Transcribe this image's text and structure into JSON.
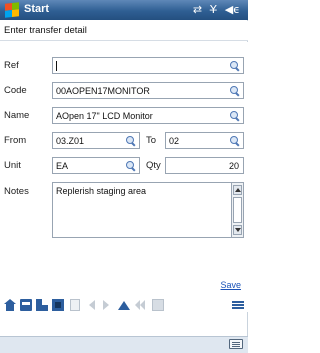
{
  "titlebar": {
    "title": "Start",
    "icons": [
      "windows-logo-icon",
      "connectivity-icon",
      "signal-icon",
      "volume-icon"
    ]
  },
  "header": {
    "text": "Enter transfer detail"
  },
  "form": {
    "ref": {
      "label": "Ref",
      "value": ""
    },
    "code": {
      "label": "Code",
      "value": "00AOPEN17MONITOR"
    },
    "name": {
      "label": "Name",
      "value": "AOpen 17\" LCD Monitor"
    },
    "from": {
      "label": "From",
      "value": "03.Z01"
    },
    "to": {
      "label": "To",
      "value": "02"
    },
    "unit": {
      "label": "Unit",
      "value": "EA"
    },
    "qty": {
      "label": "Qty",
      "value": "20"
    },
    "notes": {
      "label": "Notes",
      "value": "Replerish staging area"
    }
  },
  "actions": {
    "save_label": "Save"
  },
  "toolbar": {
    "icons": [
      "home-icon",
      "box-icon",
      "truck-icon",
      "document-icon",
      "trash-icon",
      "left-arrow-icon",
      "right-arrow-icon",
      "up-arrow-icon",
      "double-left-icon",
      "printer-icon",
      "menu-icon"
    ]
  },
  "colors": {
    "titlebar": "#2f5f93",
    "accent": "#2d5e9e",
    "link": "#1b53b8",
    "field_border": "#98a4b2"
  }
}
